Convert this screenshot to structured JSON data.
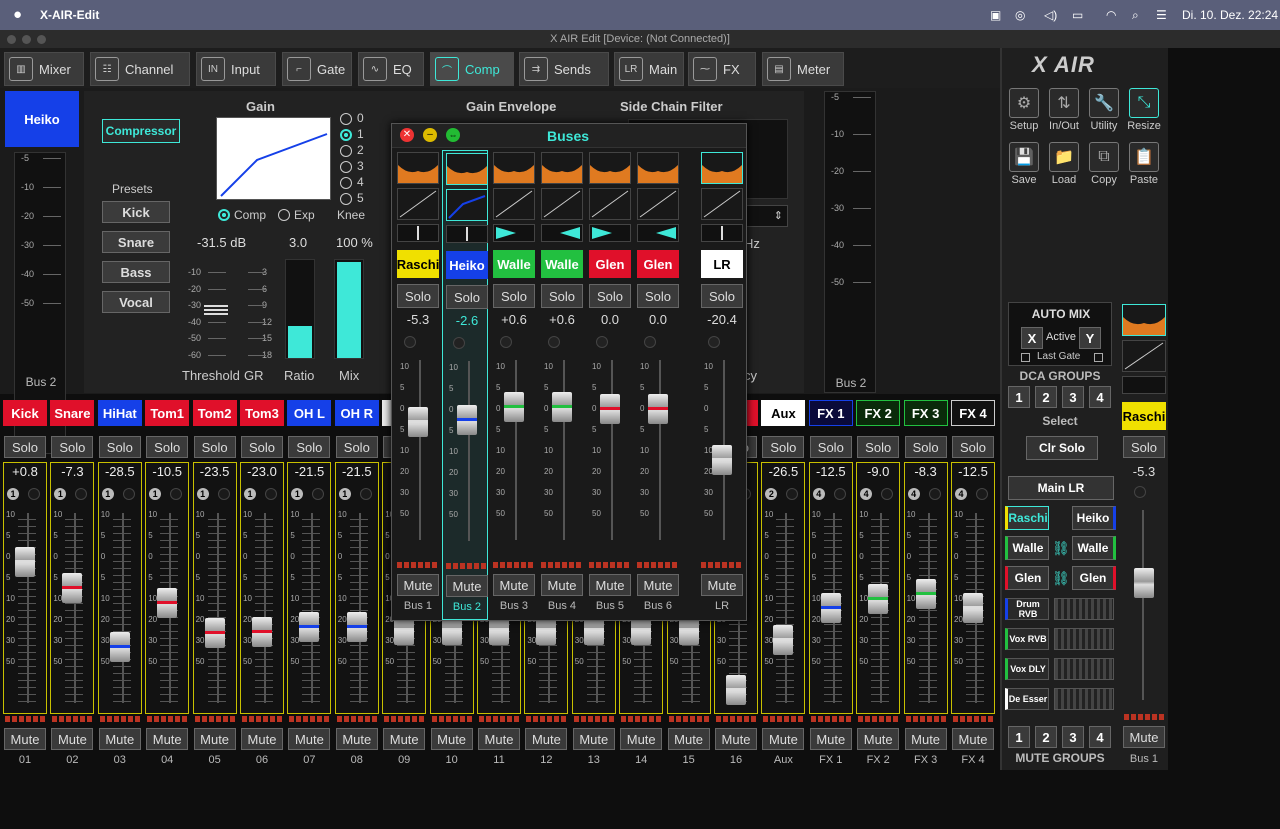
{
  "menubar": {
    "app": "X-AIR-Edit",
    "clock": "Di. 10. Dez.  22:24"
  },
  "window": {
    "title": "X AIR Edit [Device: (Not Connected)]"
  },
  "tabs": [
    {
      "label": "Mixer",
      "icon": "mixer-icon",
      "glyph": "▥"
    },
    {
      "label": "Channel",
      "icon": "channel-icon",
      "glyph": "☷"
    },
    {
      "label": "Input",
      "icon": "input-icon",
      "glyph": "IN"
    },
    {
      "label": "Gate",
      "icon": "gate-icon",
      "glyph": "⌐"
    },
    {
      "label": "EQ",
      "icon": "eq-icon",
      "glyph": "∿"
    },
    {
      "label": "Comp",
      "icon": "comp-icon",
      "glyph": "⌒",
      "active": true
    },
    {
      "label": "Sends",
      "icon": "sends-icon",
      "glyph": "⇉"
    },
    {
      "label": "Main",
      "icon": "main-icon",
      "glyph": "LR"
    },
    {
      "label": "FX",
      "icon": "fx-icon",
      "glyph": "⁓"
    },
    {
      "label": "Meter",
      "icon": "meter-icon",
      "glyph": "▤"
    }
  ],
  "channel": {
    "name": "Heiko",
    "compressor_label": "Compressor",
    "gain_title": "Gain",
    "gain_envelope": "Gain Envelope",
    "side_chain": "Side Chain Filter",
    "presets_title": "Presets",
    "presets": [
      "Kick",
      "Snare",
      "Bass",
      "Vocal"
    ],
    "knee_options": [
      "0",
      "1",
      "2",
      "3",
      "4",
      "5"
    ],
    "knee_label": "Knee",
    "knee_selected": 1,
    "mode_comp": "Comp",
    "mode_exp": "Exp",
    "threshold": "-31.5 dB",
    "ratio": "3.0",
    "mix": "100 %",
    "threshold_label": "Threshold",
    "gr_label": "GR",
    "ratio_label": "Ratio",
    "mix_label": "Mix",
    "threshold_scale": [
      "-10",
      "-20",
      "-30",
      "-40",
      "-50",
      "-60"
    ],
    "gr_scale": [
      "3",
      "6",
      "9",
      "12",
      "15",
      "18"
    ],
    "ratio_level": 0.33,
    "mix_level": 1.0,
    "left_meter_label": "Bus 2",
    "right_meter_label": "Bus 2",
    "meter_scale": [
      "-5",
      "-10",
      "-20",
      "-30",
      "-40",
      "-50"
    ],
    "hz_label": "Hz",
    "frequency_frag": "cy"
  },
  "strips": [
    {
      "name": "Kick",
      "color": "#e0102a",
      "val": "+0.8",
      "dca": "1",
      "label": "01",
      "stripe": "#ddd",
      "pos": 0.2
    },
    {
      "name": "Snare",
      "color": "#e0102a",
      "val": "-7.3",
      "dca": "1",
      "label": "02",
      "stripe": "#e0102a",
      "pos": 0.35
    },
    {
      "name": "HiHat",
      "color": "#1540e8",
      "val": "-28.5",
      "dca": "1",
      "label": "03",
      "stripe": "#1540e8",
      "pos": 0.7
    },
    {
      "name": "Tom1",
      "color": "#e0102a",
      "val": "-10.5",
      "dca": "1",
      "label": "04",
      "stripe": "#e0102a",
      "pos": 0.44
    },
    {
      "name": "Tom2",
      "color": "#e0102a",
      "val": "-23.5",
      "dca": "1",
      "label": "05",
      "stripe": "#e0102a",
      "pos": 0.62
    },
    {
      "name": "Tom3",
      "color": "#e0102a",
      "val": "-23.0",
      "dca": "1",
      "label": "06",
      "stripe": "#e0102a",
      "pos": 0.61
    },
    {
      "name": "OH L",
      "color": "#1540e8",
      "val": "-21.5",
      "dca": "1",
      "label": "07",
      "stripe": "#1540e8",
      "pos": 0.58
    },
    {
      "name": "OH R",
      "color": "#1540e8",
      "val": "-21.5",
      "dca": "1",
      "label": "08",
      "stripe": "#1540e8",
      "pos": 0.58
    },
    {
      "name": "",
      "color": "#eee",
      "val": "",
      "dca": "",
      "label": "09",
      "stripe": "#ddd",
      "pos": 0.6
    },
    {
      "name": "",
      "color": "#eee",
      "val": "",
      "dca": "",
      "label": "10",
      "stripe": "#ddd",
      "pos": 0.6
    },
    {
      "name": "",
      "color": "#eee",
      "val": "",
      "dca": "",
      "label": "11",
      "stripe": "#ddd",
      "pos": 0.6
    },
    {
      "name": "",
      "color": "#eee",
      "val": "",
      "dca": "",
      "label": "12",
      "stripe": "#ddd",
      "pos": 0.6
    },
    {
      "name": "",
      "color": "#eee",
      "val": "",
      "dca": "",
      "label": "13",
      "stripe": "#ddd",
      "pos": 0.6
    },
    {
      "name": "",
      "color": "#eee",
      "val": "",
      "dca": "",
      "label": "14",
      "stripe": "#ddd",
      "pos": 0.6
    },
    {
      "name": "",
      "color": "#eee",
      "val": "",
      "dca": "",
      "label": "15",
      "stripe": "#ddd",
      "pos": 0.6
    },
    {
      "name": "",
      "color": "#e0102a",
      "val": "",
      "dca": "",
      "label": "16",
      "stripe": "#ddd",
      "pos": 0.95
    },
    {
      "name": "Aux",
      "color": "#ffffff",
      "val": "-26.5",
      "dca": "2",
      "label": "Aux",
      "stripe": "#ddd",
      "pos": 0.66
    },
    {
      "name": "FX 1",
      "color": "#0a0a3a",
      "val": "-12.5",
      "dca": "4",
      "label": "FX 1",
      "stripe": "#1540e8",
      "pos": 0.47
    },
    {
      "name": "FX 2",
      "color": "#0a2a0a",
      "val": "-9.0",
      "dca": "4",
      "label": "FX 2",
      "stripe": "#22c040",
      "pos": 0.42
    },
    {
      "name": "FX 3",
      "color": "#0a2a0a",
      "val": "-8.3",
      "dca": "4",
      "label": "FX 3",
      "stripe": "#22c040",
      "pos": 0.39
    },
    {
      "name": "FX 4",
      "color": "#111111",
      "val": "-12.5",
      "dca": "4",
      "label": "FX 4",
      "stripe": "#ddd",
      "pos": 0.47
    }
  ],
  "common": {
    "solo": "Solo",
    "mute": "Mute"
  },
  "buses": {
    "title": "Buses",
    "strips": [
      {
        "name": "Raschi",
        "color": "#f0e000",
        "text": "#000",
        "val": "-5.3",
        "label": "Bus 1",
        "pos": 0.3,
        "stripe": "#ddd",
        "pan": "center"
      },
      {
        "name": "Heiko",
        "color": "#1540e8",
        "text": "#fff",
        "val": "-2.6",
        "label": "Bus 2",
        "pos": 0.28,
        "stripe": "#1540e8",
        "pan": "center",
        "selected": true
      },
      {
        "name": "Walle",
        "color": "#22c040",
        "text": "#fff",
        "val": "+0.6",
        "label": "Bus 3",
        "pos": 0.2,
        "stripe": "#22c040",
        "pan": "left"
      },
      {
        "name": "Walle",
        "color": "#22c040",
        "text": "#fff",
        "val": "+0.6",
        "label": "Bus 4",
        "pos": 0.2,
        "stripe": "#22c040",
        "pan": "right"
      },
      {
        "name": "Glen",
        "color": "#e0102a",
        "text": "#fff",
        "val": "0.0",
        "label": "Bus 5",
        "pos": 0.21,
        "stripe": "#e0102a",
        "pan": "left"
      },
      {
        "name": "Glen",
        "color": "#e0102a",
        "text": "#fff",
        "val": "0.0",
        "label": "Bus 6",
        "pos": 0.21,
        "stripe": "#e0102a",
        "pan": "right"
      },
      {
        "name": "LR",
        "color": "#ffffff",
        "text": "#000",
        "val": "-20.4",
        "label": "LR",
        "pos": 0.55,
        "stripe": "#ddd",
        "pan": "center"
      }
    ]
  },
  "right": {
    "logo": "X AIR",
    "tools": [
      {
        "label": "Setup",
        "icon": "gear-icon",
        "glyph": "⚙"
      },
      {
        "label": "In/Out",
        "icon": "inout-icon",
        "glyph": "⇅"
      },
      {
        "label": "Utility",
        "icon": "wrench-icon",
        "glyph": "🔧"
      },
      {
        "label": "Resize",
        "icon": "resize-icon",
        "glyph": "⤡"
      }
    ],
    "file": [
      {
        "label": "Save",
        "icon": "save-icon",
        "glyph": "💾"
      },
      {
        "label": "Load",
        "icon": "folder-icon",
        "glyph": "📁"
      },
      {
        "label": "Copy",
        "icon": "copy-icon",
        "glyph": "⧉"
      },
      {
        "label": "Paste",
        "icon": "paste-icon",
        "glyph": "📋"
      }
    ],
    "automix": "AUTO MIX",
    "automix_x": "X",
    "automix_active": "Active",
    "automix_y": "Y",
    "last_gate": "Last Gate",
    "dca_groups": "DCA GROUPS",
    "dca": [
      "1",
      "2",
      "3",
      "4"
    ],
    "select": "Select",
    "clr_solo": "Clr Solo",
    "main_lr": "Main LR",
    "dca_names": [
      [
        "Raschi",
        "Heiko"
      ],
      [
        "Walle",
        "Walle"
      ],
      [
        "Glen",
        "Glen"
      ]
    ],
    "fx": [
      {
        "label": "Drum RVB"
      },
      {
        "label": "Vox RVB"
      },
      {
        "label": "Vox DLY"
      },
      {
        "label": "De Esser"
      }
    ],
    "mute_groups": "MUTE GROUPS",
    "mg": [
      "1",
      "2",
      "3",
      "4"
    ],
    "bus1": {
      "name": "Raschi",
      "val": "-5.3",
      "label": "Bus 1"
    }
  }
}
